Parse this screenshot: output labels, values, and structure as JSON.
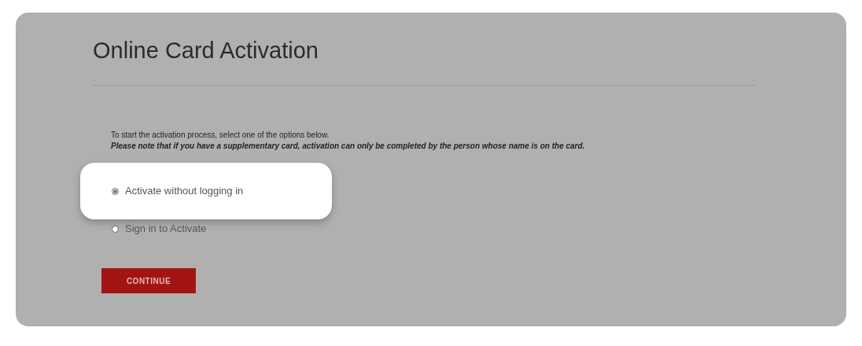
{
  "title": "Online Card Activation",
  "intro": "To start the activation process, select one of the options below.",
  "note": "Please note that if you have a supplementary card, activation can only be completed by the person whose name is on the card.",
  "options": [
    {
      "label": "Activate without logging in",
      "selected": true,
      "highlighted": true
    },
    {
      "label": "Sign in to Activate",
      "selected": false,
      "highlighted": false
    }
  ],
  "button": "CONTINUE"
}
